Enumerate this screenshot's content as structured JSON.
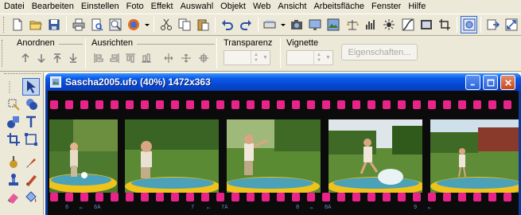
{
  "menu": [
    "Datei",
    "Bearbeiten",
    "Einstellen",
    "Foto",
    "Effekt",
    "Auswahl",
    "Objekt",
    "Web",
    "Ansicht",
    "Arbeitsfläche",
    "Fenster",
    "Hilfe"
  ],
  "toolbar_icons": [
    "new-document-icon",
    "open-folder-icon",
    "save-icon",
    "print-icon",
    "print-preview-icon",
    "zoom-preview-icon",
    "browser-icon",
    "cut-icon",
    "copy-icon",
    "paste-icon",
    "undo-icon",
    "redo-icon",
    "scanner-icon",
    "camera-icon",
    "screen-capture-icon",
    "image-info-icon",
    "scale-icon",
    "histogram-icon",
    "effect-icon",
    "curve-icon",
    "frame-icon",
    "crop-icon",
    "settings-icon",
    "export-icon",
    "resize-icon"
  ],
  "properties": {
    "align_group": "Anordnen",
    "distribute_group": "Ausrichten",
    "transparency_label": "Transparenz",
    "vignette_label": "Vignette",
    "properties_button": "Eigenschaften..."
  },
  "document": {
    "title": "Sascha2005.ufo (40%) 1472x363"
  },
  "film": {
    "edge_marks": [
      "6",
      "▻",
      "6A",
      "7",
      "▻",
      "7A",
      "8",
      "▻",
      "8A",
      "9",
      "▻"
    ]
  },
  "colors": {
    "sprocket": "#e8248a",
    "titlebar": "#0a5be8",
    "film": "#0b0b0b"
  }
}
